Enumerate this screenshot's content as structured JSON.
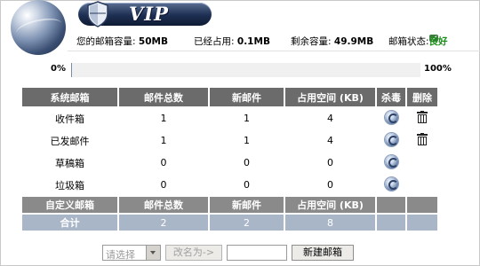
{
  "header": {
    "badge_text": "VIP"
  },
  "quota": {
    "capacity_label": "您的邮箱容量:",
    "capacity_value": "50MB",
    "used_label": "已经占用:",
    "used_value": "0.1MB",
    "remaining_label": "剩余容量:",
    "remaining_value": "49.9MB",
    "status_label": "邮箱状态:",
    "status_value": "良好",
    "status_icon": "mail-check-icon",
    "status_color": "#1a8f1a"
  },
  "progress": {
    "min_label": "0%",
    "max_label": "100%",
    "used_fraction": 0.002
  },
  "table": {
    "headers": [
      "系统邮箱",
      "邮件总数",
      "新邮件",
      "占用空间 (KB)",
      "杀毒",
      "删除"
    ],
    "rows": [
      {
        "name": "收件箱",
        "total": "1",
        "new": "1",
        "size": "4",
        "scan_icon": "antivirus-icon",
        "delete_icon": "trash-icon"
      },
      {
        "name": "已发邮件",
        "total": "1",
        "new": "1",
        "size": "4",
        "scan_icon": "antivirus-icon",
        "delete_icon": "trash-icon"
      },
      {
        "name": "草稿箱",
        "total": "0",
        "new": "0",
        "size": "0",
        "scan_icon": "antivirus-icon"
      },
      {
        "name": "垃圾箱",
        "total": "0",
        "new": "0",
        "size": "0",
        "scan_icon": "antivirus-icon"
      }
    ],
    "custom_headers": [
      "自定义邮箱",
      "邮件总数",
      "新邮件",
      "占用空间 (KB)"
    ],
    "total_row": {
      "label": "合计",
      "total": "2",
      "new": "2",
      "size": "8"
    }
  },
  "controls": {
    "select_placeholder": "请选择",
    "rename_button": "改名为->",
    "rename_value": "",
    "new_folder_button": "新建邮箱"
  },
  "colors": {
    "header_row": "#6b6b6b",
    "custom_row": "#8a8a8a",
    "total_row": "#a9b6c8",
    "progress_fill": "#7a8ca6"
  }
}
